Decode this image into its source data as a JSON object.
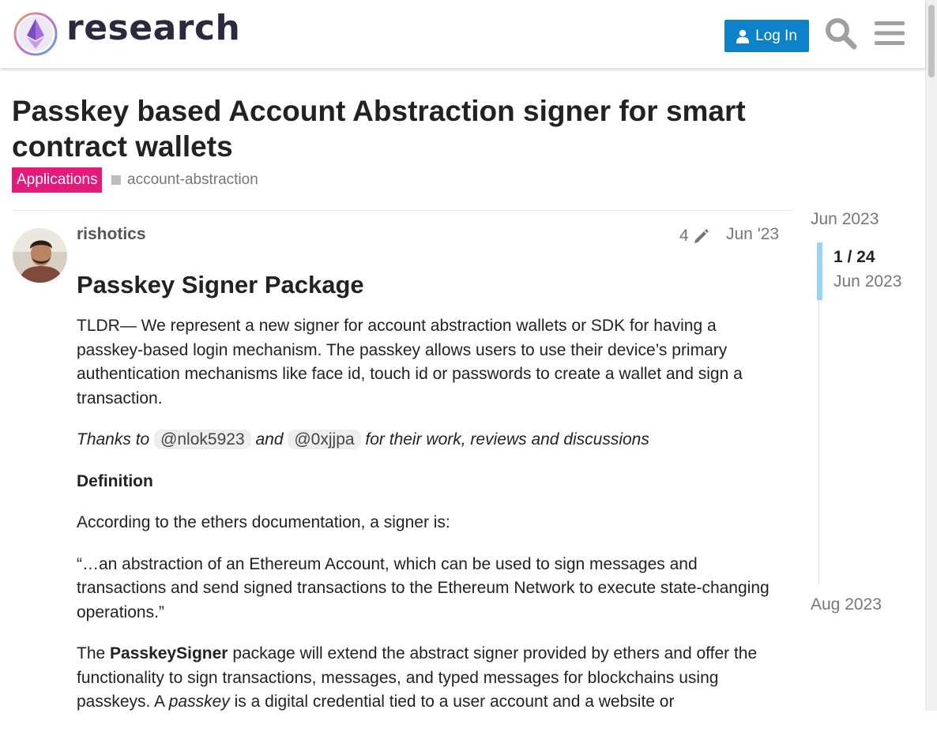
{
  "header": {
    "site_name": "research",
    "login_label": "Log In"
  },
  "topic": {
    "title": "Passkey based Account Abstraction signer for smart contract wallets",
    "category": "Applications",
    "category_color": "#e5197a",
    "tag": "account-abstraction"
  },
  "post": {
    "author": "rishotics",
    "edit_count": "4",
    "date": "Jun '23",
    "heading": "Passkey Signer Package",
    "tldr": "TLDR— We represent a new signer for account abstraction wallets or SDK for having a passkey-based login mechanism. The passkey allows users to use their device’s primary authentication mechanisms like face id, touch id or passwords to create a wallet and sign a transaction.",
    "thanks_prefix": "Thanks to",
    "mention_1": "@nlok5923",
    "thanks_and": "and",
    "mention_2": "@0xjjpa",
    "thanks_suffix": "for their work, reviews and discussions",
    "definition_heading": "Definition",
    "definition_intro": "According to the ethers documentation, a signer is:",
    "quote": "“…an abstraction of an Ethereum Account, which can be used to sign messages and transactions and send signed transactions to the Ethereum Network to execute state-changing operations.”",
    "para_the": "The",
    "para_bold": "PasskeySigner",
    "para_rest": "package will extend the abstract signer provided by ethers and offer the functionality to sign transactions, messages, and typed messages for blockchains using passkeys. A",
    "para_italic": "passkey",
    "para_end": "is a digital credential tied to a user account and a website or"
  },
  "timeline": {
    "start_date": "Jun 2023",
    "position": "1 / 24",
    "position_date": "Jun 2023",
    "end_date": "Aug 2023"
  },
  "colors": {
    "accent": "#0e82c8",
    "timeline_handle": "#9ad4f3"
  }
}
